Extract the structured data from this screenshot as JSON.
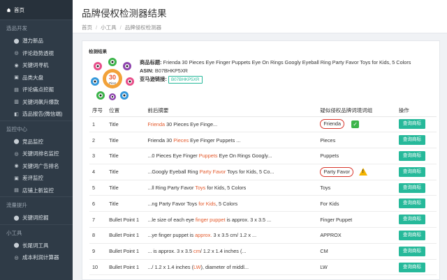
{
  "sidebar": {
    "home": "首页",
    "sections": [
      {
        "title": "选品开发",
        "items": [
          "潜力新品",
          "评论趋势透视",
          "关键词寻机",
          "品类大盘",
          "评论痛点挖掘",
          "关键词飙升爆款",
          "选品报告(微信端)"
        ]
      },
      {
        "title": "监控中心",
        "items": [
          "竞品监控",
          "关键词排名监控",
          "关键词广告排名",
          "差评监控",
          "店铺上新监控"
        ]
      },
      {
        "title": "流量提升",
        "items": [
          "关键词挖掘"
        ]
      },
      {
        "title": "小工具",
        "items": [
          "长尾词工具",
          "成本利润计算器"
        ]
      }
    ]
  },
  "header": {
    "title": "品牌侵权检测器结果",
    "breadcrumb": [
      "首页",
      "小工具",
      "品牌侵权检测器"
    ]
  },
  "panel": {
    "label": "检测结果",
    "product": {
      "badge_number": "30",
      "badge_text": "Pics!",
      "title_label": "商品标题:",
      "title": "Frienda 30 Pieces Eye Finger Puppets Eye On Rings Googly Eyeball Ring Party Favor Toys for Kids, 5 Colors",
      "asin_label": "ASIN:",
      "asin": "B07BHKP5XR",
      "link_label": "亚马逊链接:",
      "link_tag": "B07BHKP5XR"
    }
  },
  "table": {
    "headers": [
      "序号",
      "位置",
      "前后摘要",
      "疑似侵权品牌词境词组",
      "操作"
    ],
    "action_label": "查询商标",
    "rows": [
      {
        "no": "1",
        "position": "Title",
        "pre": "",
        "hit": "Frienda",
        "post": " 30 Pieces Eye Finge...",
        "term": "Frienda",
        "circled": true,
        "flag": "check"
      },
      {
        "no": "2",
        "position": "Title",
        "pre": "Frienda 30 ",
        "hit": "Pieces",
        "post": " Eye Finger Puppets ...",
        "term": "Pieces",
        "circled": false,
        "flag": ""
      },
      {
        "no": "3",
        "position": "Title",
        "pre": "...0 Pieces Eye Finger ",
        "hit": "Puppets",
        "post": " Eye On Rings Googly...",
        "term": "Puppets",
        "circled": false,
        "flag": ""
      },
      {
        "no": "4",
        "position": "Title",
        "pre": "...Googly Eyeball Ring ",
        "hit": "Party Favor",
        "post": " Toys for Kids, 5 Co...",
        "term": "Party Favor",
        "circled": true,
        "flag": "warn"
      },
      {
        "no": "5",
        "position": "Title",
        "pre": "...ll Ring Party Favor ",
        "hit": "Toys",
        "post": " for Kids, 5 Colors",
        "term": "Toys",
        "circled": false,
        "flag": ""
      },
      {
        "no": "6",
        "position": "Title",
        "pre": "...ng Party Favor Toys ",
        "hit": "for Kids",
        "post": ", 5 Colors",
        "term": "For Kids",
        "circled": false,
        "flag": ""
      },
      {
        "no": "7",
        "position": "Bullet Point 1",
        "pre": "...le size of each eye ",
        "hit": "finger puppet",
        "post": " is approx. 3 x 3.5 ...",
        "term": "Finger Puppet",
        "circled": false,
        "flag": ""
      },
      {
        "no": "8",
        "position": "Bullet Point 1",
        "pre": "...ye finger puppet is ",
        "hit": "approx.",
        "post": " 3 x 3.5 cm/ 1.2 x ...",
        "term": "APPROX",
        "circled": false,
        "flag": ""
      },
      {
        "no": "9",
        "position": "Bullet Point 1",
        "pre": "... is approx. 3 x 3.5 ",
        "hit": "cm",
        "post": "/ 1.2 x 1.4 inches (...",
        "term": "CM",
        "circled": false,
        "flag": ""
      },
      {
        "no": "10",
        "position": "Bullet Point 1",
        "pre": ".../ 1.2 x 1.4 inches (",
        "hit": "LW",
        "post": "), diameter of middl...",
        "term": "LW",
        "circled": false,
        "flag": ""
      }
    ]
  },
  "colors": {
    "accent": "#26b99a",
    "highlight": "#e45a2c",
    "sidebar": "#2f3b47"
  }
}
